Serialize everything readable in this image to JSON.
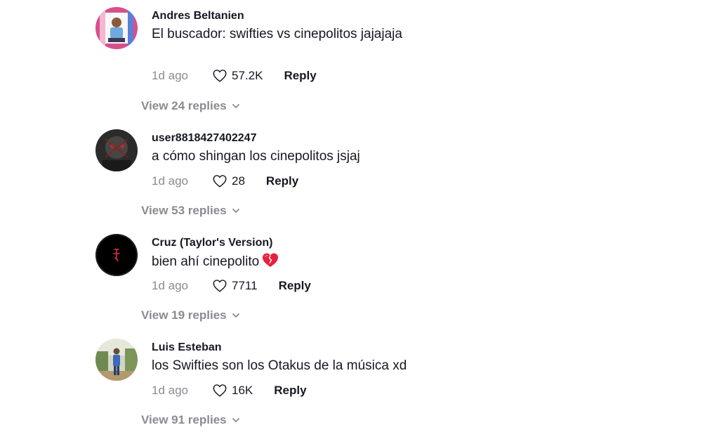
{
  "comments": [
    {
      "username": "Andres Beltanien",
      "text": "El buscador: swifties vs cinepolitos jajajaja",
      "time": "1d ago",
      "likes": "57.2K",
      "reply_label": "Reply",
      "view_replies": "View 24 replies",
      "avatar_icon": "avatar-boy-photo"
    },
    {
      "username": "user8818427402247",
      "text": "a cómo shingan los cinepolitos jsjaj",
      "time": "1d ago",
      "likes": "28",
      "reply_label": "Reply",
      "view_replies": "View 53 replies",
      "avatar_icon": "avatar-dark-photo"
    },
    {
      "username": "Cruz (Taylor's Version)",
      "text": "bien ahí cinepolito",
      "emoji": "broken-heart-emoji",
      "time": "1d ago",
      "likes": "7711",
      "reply_label": "Reply",
      "view_replies": "View 19 replies",
      "avatar_icon": "avatar-black-red-logo"
    },
    {
      "username": "Luis Esteban",
      "text": "los Swifties son los Otakus de la música xd",
      "time": "1d ago",
      "likes": "16K",
      "reply_label": "Reply",
      "view_replies": "View 91 replies",
      "avatar_icon": "avatar-outdoor-photo"
    }
  ],
  "colors": {
    "text": "#161823",
    "muted": "#8a8b91",
    "background": "#ffffff"
  }
}
